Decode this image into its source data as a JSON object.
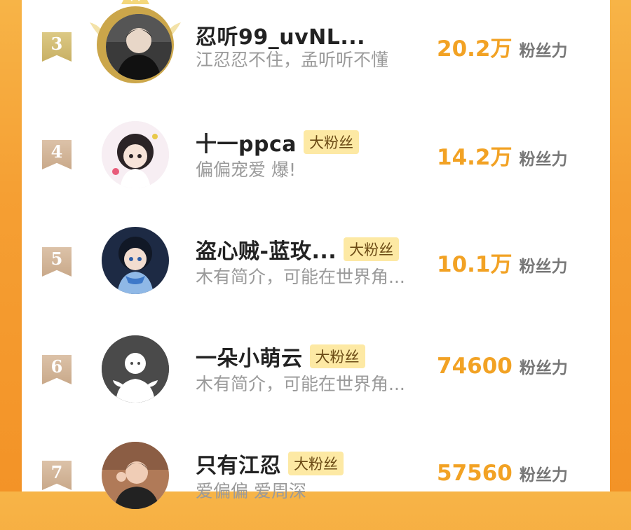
{
  "colors": {
    "page_bg": "#f5a232",
    "rank_gold": "#d4bf78",
    "rank_tan": "#d2b497",
    "score": "#f2a224",
    "fan_tag_bg": "#fde9a4"
  },
  "rows": [
    {
      "rank": "3",
      "name": "忍听99_uvNL...",
      "fan_tag": "",
      "bio": "江忍忍不住，孟听听不懂",
      "score": "20.2万",
      "score_unit": "粉丝力",
      "avatar_icon": "crowned-avatar-icon"
    },
    {
      "rank": "4",
      "name": "十一ppca",
      "fan_tag": "大粉丝",
      "bio": "偏偏宠爱 爆!",
      "score": "14.2万",
      "score_unit": "粉丝力",
      "avatar_icon": "anime-girl-avatar-icon"
    },
    {
      "rank": "5",
      "name": "盗心贼-蓝玫...",
      "fan_tag": "大粉丝",
      "bio": "木有简介，可能在世界角...",
      "score": "10.1万",
      "score_unit": "粉丝力",
      "avatar_icon": "anime-boy-avatar-icon"
    },
    {
      "rank": "6",
      "name": "一朵小萌云",
      "fan_tag": "大粉丝",
      "bio": "木有简介，可能在世界角...",
      "score": "74600",
      "score_unit": "粉丝力",
      "avatar_icon": "default-avatar-icon"
    },
    {
      "rank": "7",
      "name": "只有江忍",
      "fan_tag": "大粉丝",
      "bio": "爱偏偏 爱周深",
      "score": "57560",
      "score_unit": "粉丝力",
      "avatar_icon": "photo-avatar-icon"
    }
  ]
}
